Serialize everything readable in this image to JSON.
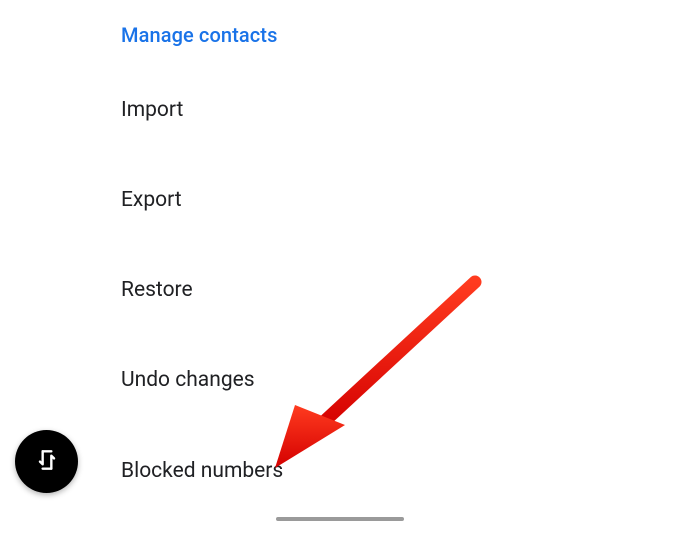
{
  "section": {
    "header": "Manage contacts"
  },
  "menu": {
    "import": "Import",
    "export": "Export",
    "restore": "Restore",
    "undo": "Undo changes",
    "blocked": "Blocked numbers"
  }
}
